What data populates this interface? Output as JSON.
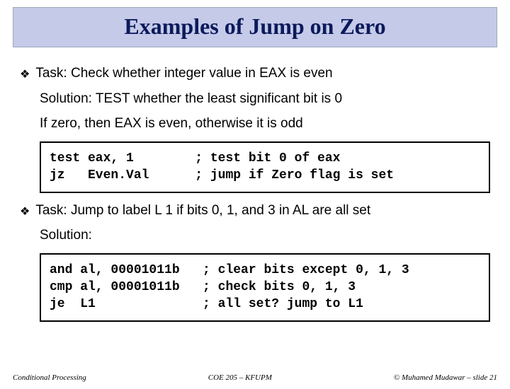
{
  "title": "Examples of Jump on Zero",
  "task1": {
    "heading": "Task: Check whether integer value in EAX is even",
    "solution_label": "Solution: TEST whether the least significant bit is 0",
    "desc": "If zero, then EAX is even, otherwise it is odd",
    "code": "test eax, 1        ; test bit 0 of eax\njz   Even.Val      ; jump if Zero flag is set"
  },
  "task2": {
    "heading": "Task: Jump to label L 1 if bits 0, 1, and 3 in AL are all set",
    "solution_label": "Solution:",
    "code": "and al, 00001011b   ; clear bits except 0, 1, 3\ncmp al, 00001011b   ; check bits 0, 1, 3\nje  L1              ; all set? jump to L1"
  },
  "footer": {
    "left": "Conditional Processing",
    "center": "COE 205 – KFUPM",
    "right": "© Muhamed Mudawar – slide 21"
  }
}
